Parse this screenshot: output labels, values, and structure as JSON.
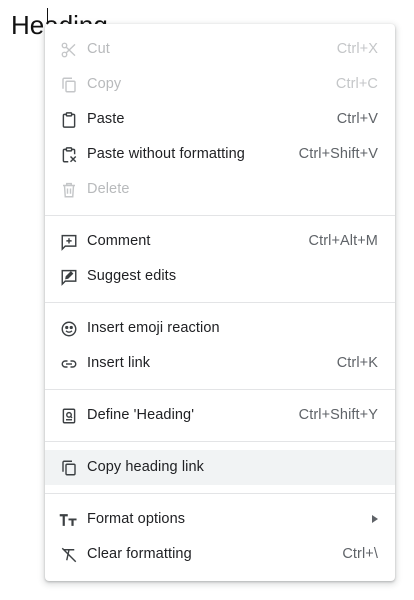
{
  "document": {
    "heading_text": "Heading"
  },
  "menu": {
    "groups": [
      [
        {
          "label": "Cut",
          "shortcut": "Ctrl+X",
          "icon": "scissors-icon",
          "enabled": false
        },
        {
          "label": "Copy",
          "shortcut": "Ctrl+C",
          "icon": "copy-icon",
          "enabled": false
        },
        {
          "label": "Paste",
          "shortcut": "Ctrl+V",
          "icon": "clipboard-icon",
          "enabled": true
        },
        {
          "label": "Paste without formatting",
          "shortcut": "Ctrl+Shift+V",
          "icon": "paste-plain-icon",
          "enabled": true
        },
        {
          "label": "Delete",
          "shortcut": "",
          "icon": "trash-icon",
          "enabled": false
        }
      ],
      [
        {
          "label": "Comment",
          "shortcut": "Ctrl+Alt+M",
          "icon": "add-comment-icon",
          "enabled": true
        },
        {
          "label": "Suggest edits",
          "shortcut": "",
          "icon": "suggest-edits-icon",
          "enabled": true
        }
      ],
      [
        {
          "label": "Insert emoji reaction",
          "shortcut": "",
          "icon": "emoji-icon",
          "enabled": true
        },
        {
          "label": "Insert link",
          "shortcut": "Ctrl+K",
          "icon": "link-icon",
          "enabled": true
        }
      ],
      [
        {
          "label": "Define 'Heading'",
          "shortcut": "Ctrl+Shift+Y",
          "icon": "define-icon",
          "enabled": true
        }
      ],
      [
        {
          "label": "Copy heading link",
          "shortcut": "",
          "icon": "copy-icon",
          "enabled": true,
          "highlighted": true
        }
      ],
      [
        {
          "label": "Format options",
          "shortcut": "",
          "icon": "text-format-icon",
          "enabled": true,
          "submenu": true
        },
        {
          "label": "Clear formatting",
          "shortcut": "Ctrl+\\",
          "icon": "clear-format-icon",
          "enabled": true
        }
      ]
    ]
  },
  "colors": {
    "text": "#202124",
    "disabled_text": "#b8babc",
    "shortcut": "#5f6368",
    "highlight": "#f1f3f4",
    "separator": "#e3e4e6"
  }
}
